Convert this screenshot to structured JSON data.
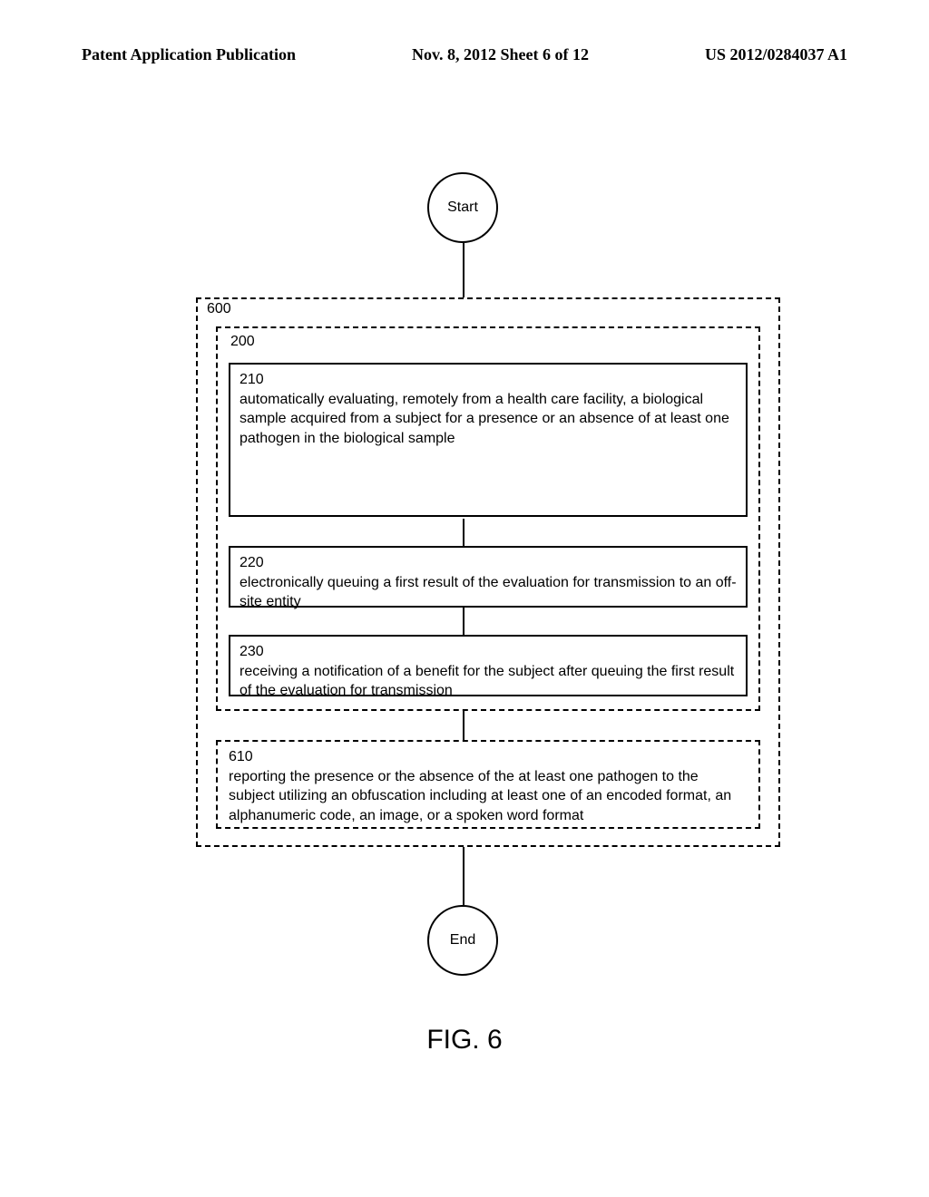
{
  "header": {
    "left": "Patent Application Publication",
    "center": "Nov. 8, 2012  Sheet 6 of 12",
    "right": "US 2012/0284037 A1"
  },
  "flow": {
    "start_label": "Start",
    "end_label": "End",
    "outer_ref": "600",
    "inner_ref": "200",
    "step210": {
      "num": "210",
      "text": "automatically evaluating, remotely from a health care facility, a biological sample acquired from a subject for a presence or an absence of at least one pathogen in the biological sample"
    },
    "step220": {
      "num": "220",
      "text": "electronically queuing a first result of the evaluation for transmission to an off-site entity"
    },
    "step230": {
      "num": "230",
      "text": "receiving a notification of a benefit for the subject after queuing the first result of the evaluation for transmission"
    },
    "step610": {
      "num": "610",
      "text": "reporting the presence or the absence of the at least one pathogen to the subject utilizing an obfuscation including at least one of an encoded format, an alphanumeric code, an image, or a spoken word format"
    }
  },
  "figure_caption": "FIG. 6"
}
